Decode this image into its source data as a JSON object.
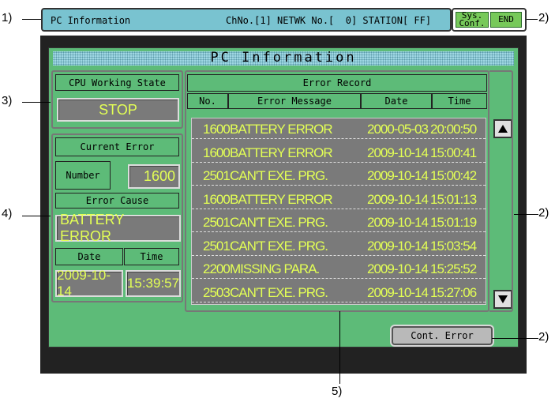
{
  "callouts": {
    "c1": "1)",
    "c2a": "2)",
    "c3": "3)",
    "c4": "4)",
    "c2b": "2)",
    "c2c": "2)",
    "c5": "5)"
  },
  "header": {
    "title": "PC Information",
    "station_info": "ChNo.[1] NETWK No.[  0] STATION[ FF]",
    "sys_conf_label": "Sys.\nConf.",
    "end_label": "END"
  },
  "screen": {
    "title": "PC Information",
    "cpu_state": {
      "heading": "CPU Working State",
      "value": "STOP"
    },
    "current_error": {
      "heading": "Current Error",
      "number_label": "Number",
      "number_value": "1600",
      "cause_label": "Error Cause",
      "cause_value": "BATTERY ERROR",
      "date_label": "Date",
      "time_label": "Time",
      "date_value": "2009-10-14",
      "time_value": "15:39:57"
    },
    "error_record": {
      "heading": "Error Record",
      "columns": [
        "No.",
        "Error Message",
        "Date",
        "Time"
      ],
      "rows": [
        {
          "no": "1600",
          "message": "BATTERY ERROR",
          "date": "2000-05-03",
          "time": "20:00:50"
        },
        {
          "no": "1600",
          "message": "BATTERY ERROR",
          "date": "2009-10-14",
          "time": "15:00:41"
        },
        {
          "no": "2501",
          "message": "CAN'T EXE. PRG.",
          "date": "2009-10-14",
          "time": "15:00:42"
        },
        {
          "no": "1600",
          "message": "BATTERY ERROR",
          "date": "2009-10-14",
          "time": "15:01:13"
        },
        {
          "no": "2501",
          "message": "CAN'T EXE. PRG.",
          "date": "2009-10-14",
          "time": "15:01:19"
        },
        {
          "no": "2501",
          "message": "CAN'T EXE. PRG.",
          "date": "2009-10-14",
          "time": "15:03:54"
        },
        {
          "no": "2200",
          "message": "MISSING PARA.",
          "date": "2009-10-14",
          "time": "15:25:52"
        },
        {
          "no": "2503",
          "message": "CAN'T EXE. PRG.",
          "date": "2009-10-14",
          "time": "15:27:06"
        }
      ],
      "scroll_up_icon": "triangle-up-icon",
      "scroll_down_icon": "triangle-down-icon"
    },
    "cont_error_label": "Cont. Error"
  },
  "colors": {
    "header_bar": "#79c3d0",
    "panel_green": "#5dbb78",
    "value_yellow": "#e3ff55",
    "button_green": "#77c95a"
  }
}
